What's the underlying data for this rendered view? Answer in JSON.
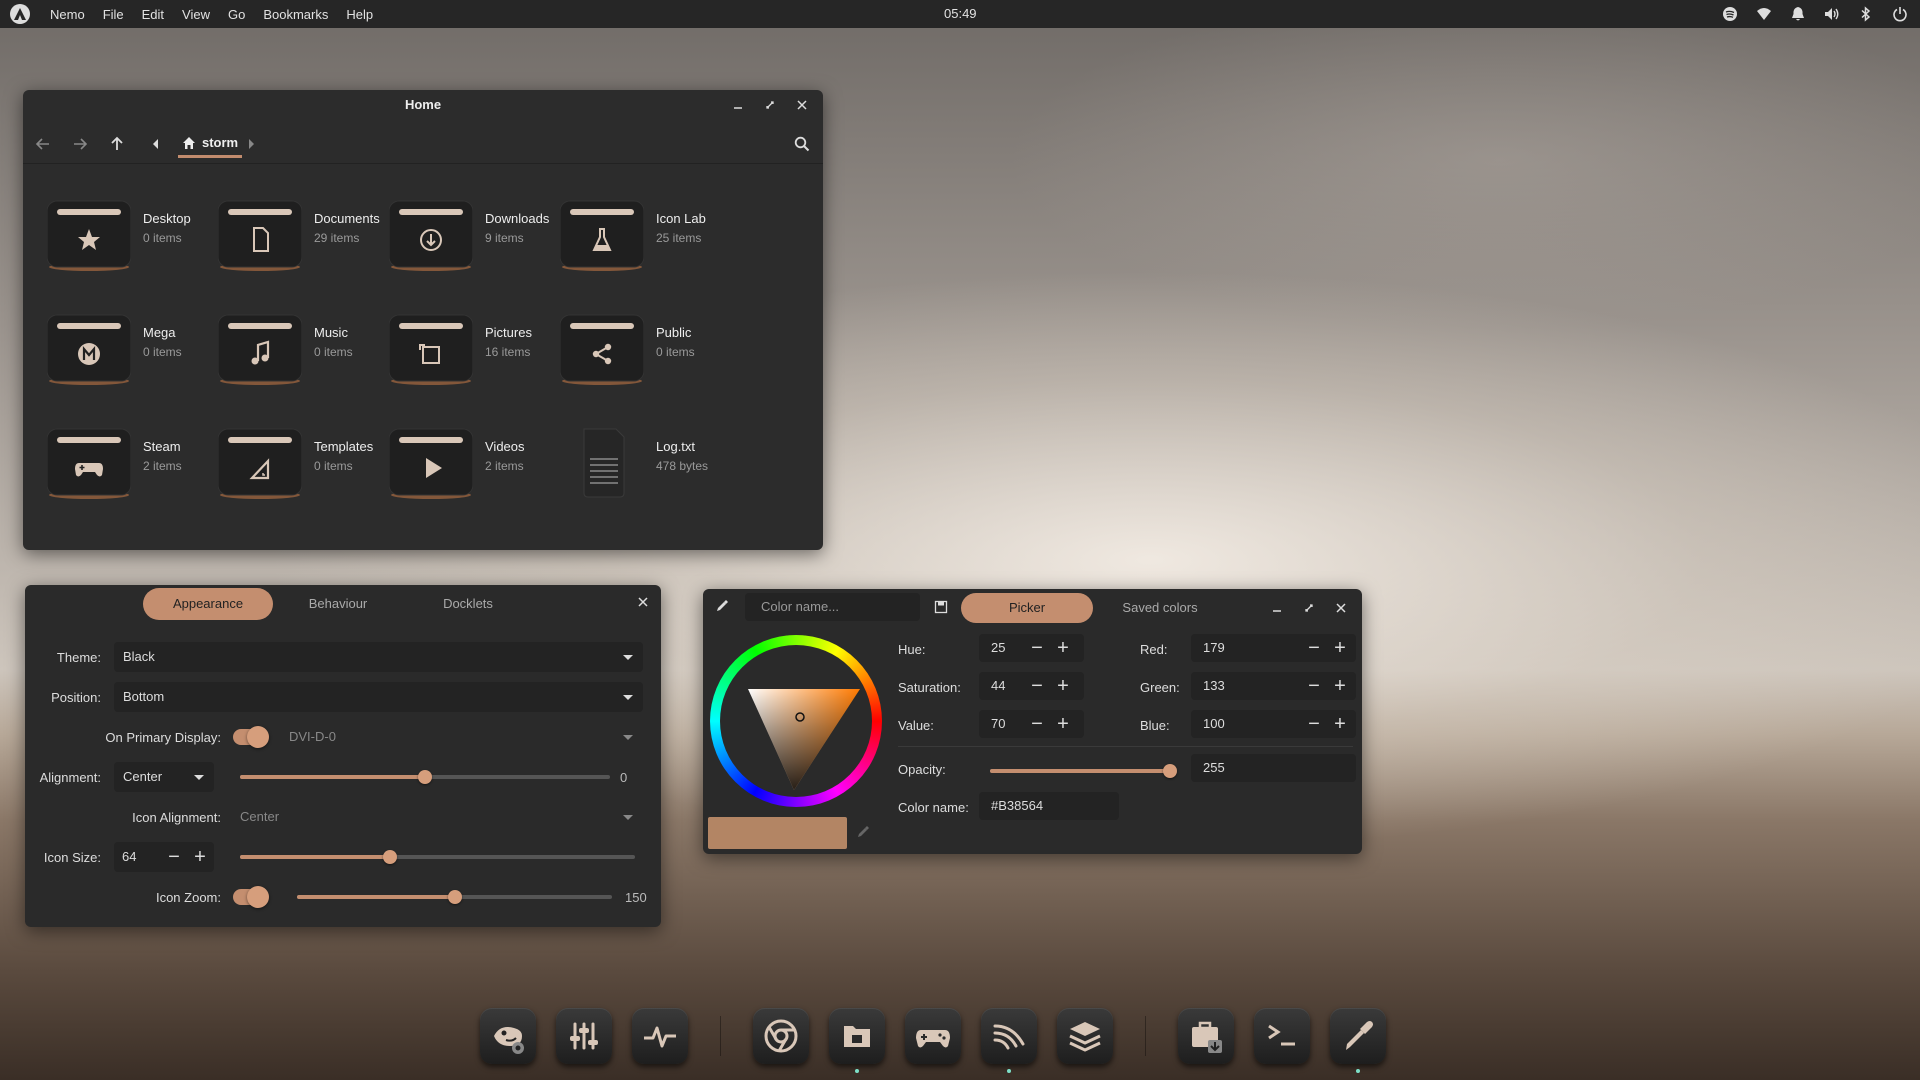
{
  "topbar": {
    "app": "Nemo",
    "menus": [
      "File",
      "Edit",
      "View",
      "Go",
      "Bookmarks",
      "Help"
    ],
    "clock": "05:49",
    "tray_icons": [
      "spotify-icon",
      "wifi-icon",
      "bell-icon",
      "volume-icon",
      "bluetooth-icon",
      "power-icon"
    ]
  },
  "file_manager": {
    "title": "Home",
    "breadcrumb": "storm",
    "items": [
      {
        "name": "Desktop",
        "sub": "0 items",
        "icon": "star"
      },
      {
        "name": "Documents",
        "sub": "29 items",
        "icon": "document"
      },
      {
        "name": "Downloads",
        "sub": "9 items",
        "icon": "download"
      },
      {
        "name": "Icon Lab",
        "sub": "25 items",
        "icon": "flask"
      },
      {
        "name": "Mega",
        "sub": "0 items",
        "icon": "mega"
      },
      {
        "name": "Music",
        "sub": "0 items",
        "icon": "music"
      },
      {
        "name": "Pictures",
        "sub": "16 items",
        "icon": "picture"
      },
      {
        "name": "Public",
        "sub": "0 items",
        "icon": "share"
      },
      {
        "name": "Steam",
        "sub": "2 items",
        "icon": "gamepad"
      },
      {
        "name": "Templates",
        "sub": "0 items",
        "icon": "template"
      },
      {
        "name": "Videos",
        "sub": "2 items",
        "icon": "play"
      },
      {
        "name": "Log.txt",
        "sub": "478 bytes",
        "icon": "textfile"
      }
    ]
  },
  "dock_settings": {
    "tabs": [
      "Appearance",
      "Behaviour",
      "Docklets"
    ],
    "active_tab": "Appearance",
    "theme_label": "Theme:",
    "theme_value": "Black",
    "position_label": "Position:",
    "position_value": "Bottom",
    "primary_label": "On Primary Display:",
    "primary_value": "DVI-D-0",
    "alignment_label": "Alignment:",
    "alignment_value": "Center",
    "alignment_offset": "0",
    "alignment_slider": 0.5,
    "icon_alignment_label": "Icon Alignment:",
    "icon_alignment_value": "Center",
    "icon_size_label": "Icon Size:",
    "icon_size_value": "64",
    "icon_size_slider": 0.38,
    "icon_zoom_label": "Icon Zoom:",
    "icon_zoom_value": "150",
    "icon_zoom_slider": 0.5
  },
  "color_picker": {
    "name_placeholder": "Color name...",
    "tabs": [
      "Picker",
      "Saved colors"
    ],
    "active_tab": "Picker",
    "hue_label": "Hue:",
    "hue": "25",
    "sat_label": "Saturation:",
    "sat": "44",
    "value_label": "Value:",
    "value": "70",
    "red_label": "Red:",
    "red": "179",
    "green_label": "Green:",
    "green": "133",
    "blue_label": "Blue:",
    "blue": "100",
    "opacity_label": "Opacity:",
    "opacity": "255",
    "opacity_slider": 1.0,
    "colorname_label": "Color name:",
    "colorname": "#B38564",
    "swatch_color": "#B38564"
  },
  "accent_color": "#C48E6F",
  "dock_icons": [
    "gimp-icon",
    "mixer-icon",
    "activity-monitor-icon",
    "chrome-icon",
    "files-icon",
    "gamepad-icon",
    "wifi-scan-icon",
    "stack-icon",
    "archive-icon",
    "terminal-icon",
    "color-picker-icon"
  ]
}
